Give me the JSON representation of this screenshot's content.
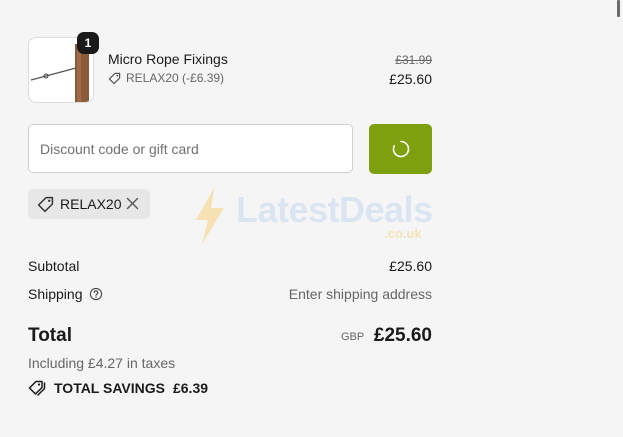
{
  "line_item": {
    "quantity": "1",
    "name": "Micro Rope Fixings",
    "discount": "RELAX20 (-£6.39)",
    "original_price": "£31.99",
    "price": "£25.60"
  },
  "discount_field": {
    "placeholder": "Discount code or gift card"
  },
  "applied_code": {
    "code": "RELAX20"
  },
  "watermark": {
    "text": "LatestDeals",
    "sub": ".co.uk"
  },
  "summary": {
    "subtotal_label": "Subtotal",
    "subtotal_value": "£25.60",
    "shipping_label": "Shipping",
    "shipping_value": "Enter shipping address",
    "total_label": "Total",
    "currency": "GBP",
    "total_value": "£25.60",
    "taxes": "Including £4.27 in taxes",
    "savings_label": "TOTAL SAVINGS",
    "savings_value": "£6.39"
  },
  "colors": {
    "apply_button": "#7e9f0e",
    "background": "#f5f5f5"
  },
  "icons": {
    "discount_tag": "tag-icon",
    "remove": "close-icon",
    "shipping_help": "question-circle-icon",
    "savings": "tags-icon",
    "loading": "spinner-icon"
  }
}
